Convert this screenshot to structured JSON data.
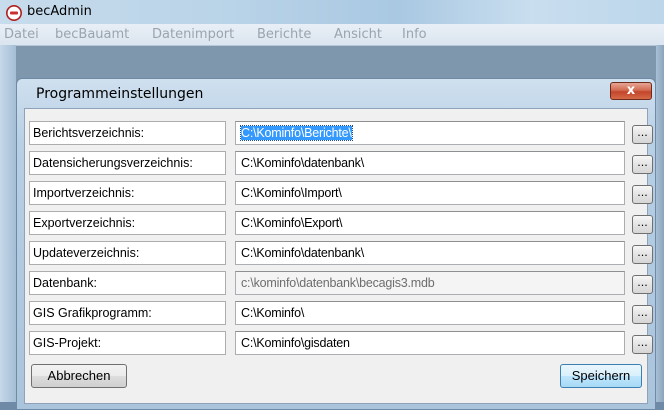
{
  "app": {
    "title": "becAdmin"
  },
  "menu": [
    "Datei",
    "becBauamt",
    "Datenimport",
    "Berichte",
    "Ansicht",
    "Info"
  ],
  "dialog": {
    "title": "Programmeinstellungen",
    "close_label": "x",
    "browse_label": "...",
    "rows": [
      {
        "label": "Berichtsverzeichnis:",
        "value": "C:\\Kominfo\\Berichte\\"
      },
      {
        "label": "Datensicherungsverzeichnis:",
        "value": "C:\\Kominfo\\datenbank\\"
      },
      {
        "label": "Importverzeichnis:",
        "value": "C:\\Kominfo\\Import\\"
      },
      {
        "label": "Exportverzeichnis:",
        "value": "C:\\Kominfo\\Export\\"
      },
      {
        "label": "Updateverzeichnis:",
        "value": "C:\\Kominfo\\datenbank\\"
      },
      {
        "label": "Datenbank:",
        "value": "c:\\kominfo\\datenbank\\becagis3.mdb"
      },
      {
        "label": "GIS Grafikprogramm:",
        "value": "C:\\Kominfo\\"
      },
      {
        "label": "GIS-Projekt:",
        "value": "C:\\Kominfo\\gisdaten"
      }
    ],
    "cancel_label": "Abbrechen",
    "save_label": "Speichern"
  },
  "colors": {
    "selection": "#3399ff",
    "close_button": "#c3452b"
  }
}
